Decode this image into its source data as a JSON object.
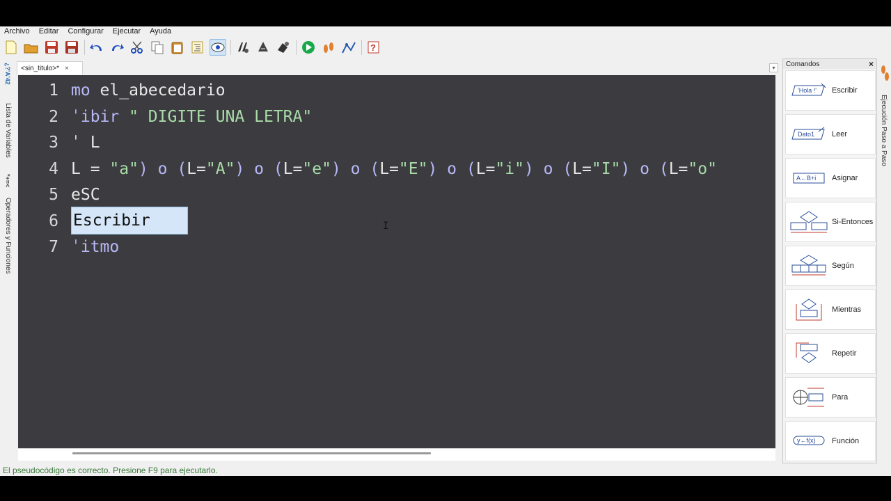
{
  "menu": [
    "Archivo",
    "Editar",
    "Configurar",
    "Ejecutar",
    "Ayuda"
  ],
  "left_panel": {
    "variables_label": "Lista de Variables",
    "operators_label": "Operadores y Funciones",
    "var_icon_text": "*+=<",
    "var_icon_text2": "¿?'A'42"
  },
  "tab": {
    "title": "<sin_titulo>*",
    "close": "×"
  },
  "editor": {
    "lines": [
      {
        "n": "1",
        "segments": [
          {
            "t": "mo",
            "c": "kw"
          },
          {
            "t": " el_abecedario",
            "c": ""
          }
        ]
      },
      {
        "n": "2",
        "segments": [
          {
            "t": "ˈibir",
            "c": "kw"
          },
          {
            "t": "  \" DIGITE UNA LETRA\"",
            "c": "str"
          }
        ]
      },
      {
        "n": "3",
        "segments": [
          {
            "t": "ˈ  L",
            "c": ""
          }
        ]
      },
      {
        "n": "4",
        "segments": [
          {
            "t": "L = ",
            "c": ""
          },
          {
            "t": "\"a\"",
            "c": "str"
          },
          {
            "t": ") o (",
            "c": "op"
          },
          {
            "t": "L=",
            "c": ""
          },
          {
            "t": "\"A\"",
            "c": "str"
          },
          {
            "t": ") o (",
            "c": "op"
          },
          {
            "t": "L=",
            "c": ""
          },
          {
            "t": "\"e\"",
            "c": "str"
          },
          {
            "t": ") o (",
            "c": "op"
          },
          {
            "t": "L=",
            "c": ""
          },
          {
            "t": "\"E\"",
            "c": "str"
          },
          {
            "t": ") o (",
            "c": "op"
          },
          {
            "t": "L=",
            "c": ""
          },
          {
            "t": "\"i\"",
            "c": "str"
          },
          {
            "t": ") o (",
            "c": "op"
          },
          {
            "t": "L=",
            "c": ""
          },
          {
            "t": "\"I\"",
            "c": "str"
          },
          {
            "t": ") o (",
            "c": "op"
          },
          {
            "t": "L=",
            "c": ""
          },
          {
            "t": "\"o\"",
            "c": "str"
          }
        ]
      },
      {
        "n": "5",
        "segments": [
          {
            "t": "eSC",
            "c": ""
          }
        ]
      },
      {
        "n": "6",
        "segments": [
          {
            "t": "",
            "c": ""
          }
        ]
      },
      {
        "n": "7",
        "segments": [
          {
            "t": "ˈitmo",
            "c": "kw"
          }
        ]
      }
    ],
    "autocomplete": "Escribir"
  },
  "status": "El pseudocódigo es correcto. Presione F9 para ejecutarlo.",
  "commands": {
    "title": "Comandos",
    "close": "×",
    "items": [
      {
        "label": "Escribir",
        "icon_text": "'Hola !'"
      },
      {
        "label": "Leer",
        "icon_text": "Dato1"
      },
      {
        "label": "Asignar",
        "icon_text": "A←B+i"
      },
      {
        "label": "Si-Entonces",
        "icon_text": ""
      },
      {
        "label": "Según",
        "icon_text": ""
      },
      {
        "label": "Mientras",
        "icon_text": ""
      },
      {
        "label": "Repetir",
        "icon_text": ""
      },
      {
        "label": "Para",
        "icon_text": ""
      },
      {
        "label": "Función",
        "icon_text": "y←f(x)"
      }
    ]
  },
  "right_panel": {
    "label": "Ejecución Paso a Paso"
  },
  "colors": {
    "editor_bg": "#3c3c40",
    "keyword": "#b8b8f8",
    "string": "#a8dca8",
    "status": "#3a7a3a"
  }
}
